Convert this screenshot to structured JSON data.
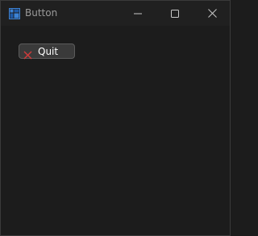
{
  "window": {
    "title": "Button",
    "app_icon": "window-grid-icon",
    "controls": {
      "minimize_icon": "minimize-icon",
      "maximize_icon": "maximize-icon",
      "close_icon": "close-icon"
    }
  },
  "content": {
    "quit_button": {
      "label": "Quit",
      "icon": "close-x-icon",
      "icon_color": "#d23a3a"
    }
  },
  "colors": {
    "background": "#1c1c1c",
    "titlebar": "#202020",
    "accent": "#3b82d6",
    "button_bg": "#3a3a3a",
    "button_border": "#5c5c5c"
  }
}
